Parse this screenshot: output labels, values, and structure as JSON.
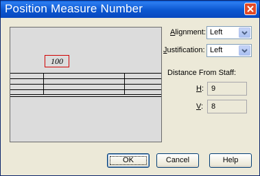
{
  "window": {
    "title": "Position Measure Number"
  },
  "preview": {
    "measure_number": "100"
  },
  "alignment": {
    "label_u": "A",
    "label_rest": "lignment:",
    "value": "Left"
  },
  "justification": {
    "label_u": "J",
    "label_rest": "ustification:",
    "value": "Left"
  },
  "distance": {
    "heading": "Distance From Staff:",
    "h_label": "H",
    "h_colon": ":",
    "h_value": "9",
    "v_label": "V",
    "v_colon": ":",
    "v_value": "8"
  },
  "buttons": {
    "ok": "OK",
    "cancel": "Cancel",
    "help": "Help"
  },
  "icons": {
    "close": "close-icon",
    "dropdown": "chevron-down-icon"
  },
  "colors": {
    "title_bar": "#0b57d0",
    "measure_box_border": "#d00000",
    "close_button": "#e24a26"
  }
}
